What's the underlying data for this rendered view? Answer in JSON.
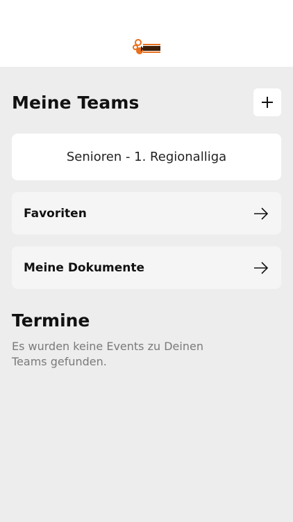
{
  "header": {
    "logo_icon": "club-logo-icon",
    "logo_colors": {
      "orange": "#e8701e",
      "dark": "#3b1d0a"
    }
  },
  "teams": {
    "title": "Meine Teams",
    "add_icon": "plus-icon",
    "items": [
      {
        "label": "Senioren - 1. Regionalliga"
      }
    ]
  },
  "links": [
    {
      "label": "Favoriten",
      "icon": "arrow-right-icon"
    },
    {
      "label": "Meine Dokumente",
      "icon": "arrow-right-icon"
    }
  ],
  "events": {
    "title": "Termine",
    "empty_message": "Es wurden keine Events zu Deinen Teams gefunden."
  }
}
